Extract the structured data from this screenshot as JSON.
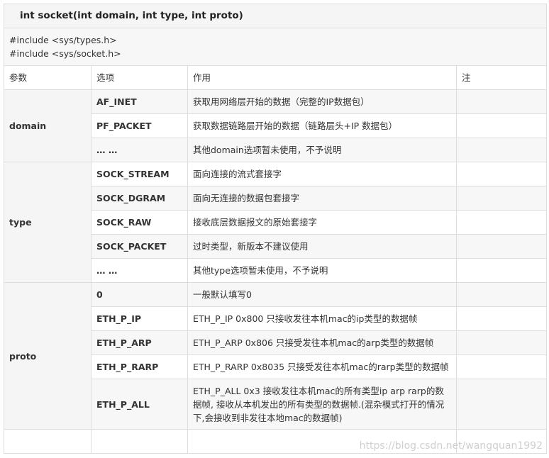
{
  "title": "int socket(int domain, int type, int proto)",
  "includes": [
    "#include <sys/types.h>",
    "#include <sys/socket.h>"
  ],
  "headers": [
    "参数",
    "选项",
    "作用",
    "注"
  ],
  "groups": [
    {
      "param": "domain",
      "rows": [
        {
          "option": "AF_INET",
          "desc": "获取用网络层开始的数据（完整的IP数据包）"
        },
        {
          "option": "PF_PACKET",
          "desc": "获取数据链路层开始的数据（链路层头+IP 数据包）"
        },
        {
          "option": "… …",
          "desc": "其他domain选项暂未使用，不予说明"
        }
      ]
    },
    {
      "param": "type",
      "rows": [
        {
          "option": "SOCK_STREAM",
          "desc": "面向连接的流式套接字"
        },
        {
          "option": "SOCK_DGRAM",
          "desc": "面向无连接的数据包套接字"
        },
        {
          "option": "SOCK_RAW",
          "desc": "接收底层数据报文的原始套接字"
        },
        {
          "option": "SOCK_PACKET",
          "desc": "过时类型，新版本不建议使用"
        },
        {
          "option": "… …",
          "desc": "其他type选项暂未使用，不予说明"
        }
      ]
    },
    {
      "param": "proto",
      "rows": [
        {
          "option": "0",
          "desc": "一般默认填写0"
        },
        {
          "option": "ETH_P_IP",
          "desc": "ETH_P_IP 0x800 只接收发往本机mac的ip类型的数据帧"
        },
        {
          "option": "ETH_P_ARP",
          "desc": "ETH_P_ARP 0x806 只接受发往本机mac的arp类型的数据帧"
        },
        {
          "option": "ETH_P_RARP",
          "desc": "ETH_P_RARP 0x8035 只接受发往本机mac的rarp类型的数据帧"
        },
        {
          "option": "ETH_P_ALL",
          "desc": "ETH_P_ALL 0x3 接收发往本机mac的所有类型ip arp rarp的数据帧, 接收从本机发出的所有类型的数据帧.(混杂模式打开的情况下,会接收到非发往本地mac的数据帧)"
        }
      ]
    }
  ],
  "watermark": "https://blog.csdn.net/wangquan1992"
}
